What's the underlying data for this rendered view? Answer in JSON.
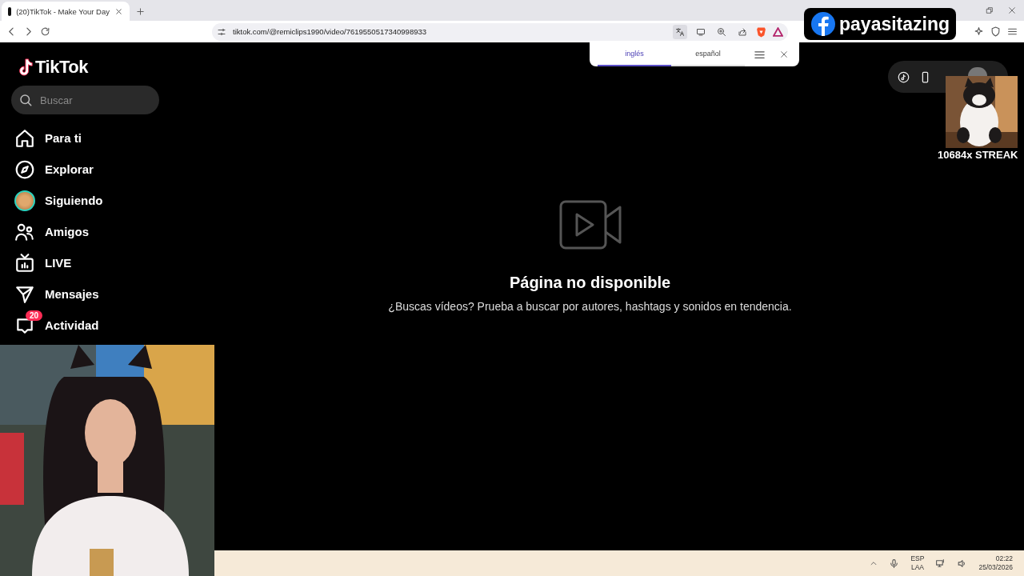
{
  "browser": {
    "tab_title": "(20)TikTok - Make Your Day",
    "url": "tiktok.com/@remiclips1990/video/7619550517340998933"
  },
  "translate_bar": {
    "languages": [
      {
        "label": "inglés",
        "selected": true
      },
      {
        "label": "español",
        "selected": false
      }
    ]
  },
  "sidebar": {
    "logo": "TikTok",
    "search": {
      "placeholder": "Buscar"
    },
    "items": [
      {
        "kind": "home",
        "label": "Para ti"
      },
      {
        "kind": "explore",
        "label": "Explorar"
      },
      {
        "kind": "following",
        "label": "Siguiendo"
      },
      {
        "kind": "friends",
        "label": "Amigos"
      },
      {
        "kind": "live",
        "label": "LIVE"
      },
      {
        "kind": "messages",
        "label": "Mensajes"
      },
      {
        "kind": "activity",
        "label": "Actividad",
        "badge": "20"
      }
    ]
  },
  "message": {
    "title": "Página no disponible",
    "text": "¿Buscas vídeos? Prueba a buscar por autores, hashtags y sonidos en tendencia."
  },
  "overlays": {
    "handle": "payasitazing",
    "streak": "10684x STREAK"
  },
  "taskbar": {
    "language": [
      "ESP",
      "LAA"
    ],
    "time": "02:22",
    "date": "25/03/2026"
  }
}
